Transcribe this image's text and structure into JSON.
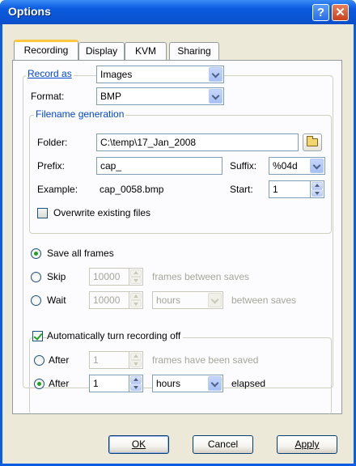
{
  "window": {
    "title": "Options",
    "help": "?",
    "close": "✕"
  },
  "tabs": [
    "Recording",
    "Display",
    "KVM",
    "Sharing"
  ],
  "record_as": {
    "label": "Record as",
    "value": "Images"
  },
  "format": {
    "label": "Format:",
    "value": "BMP"
  },
  "filename_generation": {
    "title": "Filename generation",
    "folder_label": "Folder:",
    "folder_value": "C:\\temp\\17_Jan_2008",
    "prefix_label": "Prefix:",
    "prefix_value": "cap_",
    "suffix_label": "Suffix:",
    "suffix_value": "%04d",
    "example_label": "Example:",
    "example_value": "cap_0058.bmp",
    "start_label": "Start:",
    "start_value": "1",
    "overwrite_label": "Overwrite existing files",
    "overwrite_checked": false
  },
  "frames": {
    "save_all_label": "Save all frames",
    "skip_label": "Skip",
    "skip_value": "10000",
    "skip_suffix": "frames between saves",
    "wait_label": "Wait",
    "wait_value": "10000",
    "wait_unit": "hours",
    "wait_suffix": "between saves",
    "selected": "save_all"
  },
  "auto_off": {
    "label": "Automatically turn recording off",
    "checked": true,
    "after_frames_label": "After",
    "after_frames_value": "1",
    "after_frames_suffix": "frames have been saved",
    "after_time_label": "After",
    "after_time_value": "1",
    "after_time_unit": "hours",
    "after_time_suffix": "elapsed",
    "selected": "after_time"
  },
  "buttons": {
    "ok": "OK",
    "cancel": "Cancel",
    "apply": "Apply"
  }
}
